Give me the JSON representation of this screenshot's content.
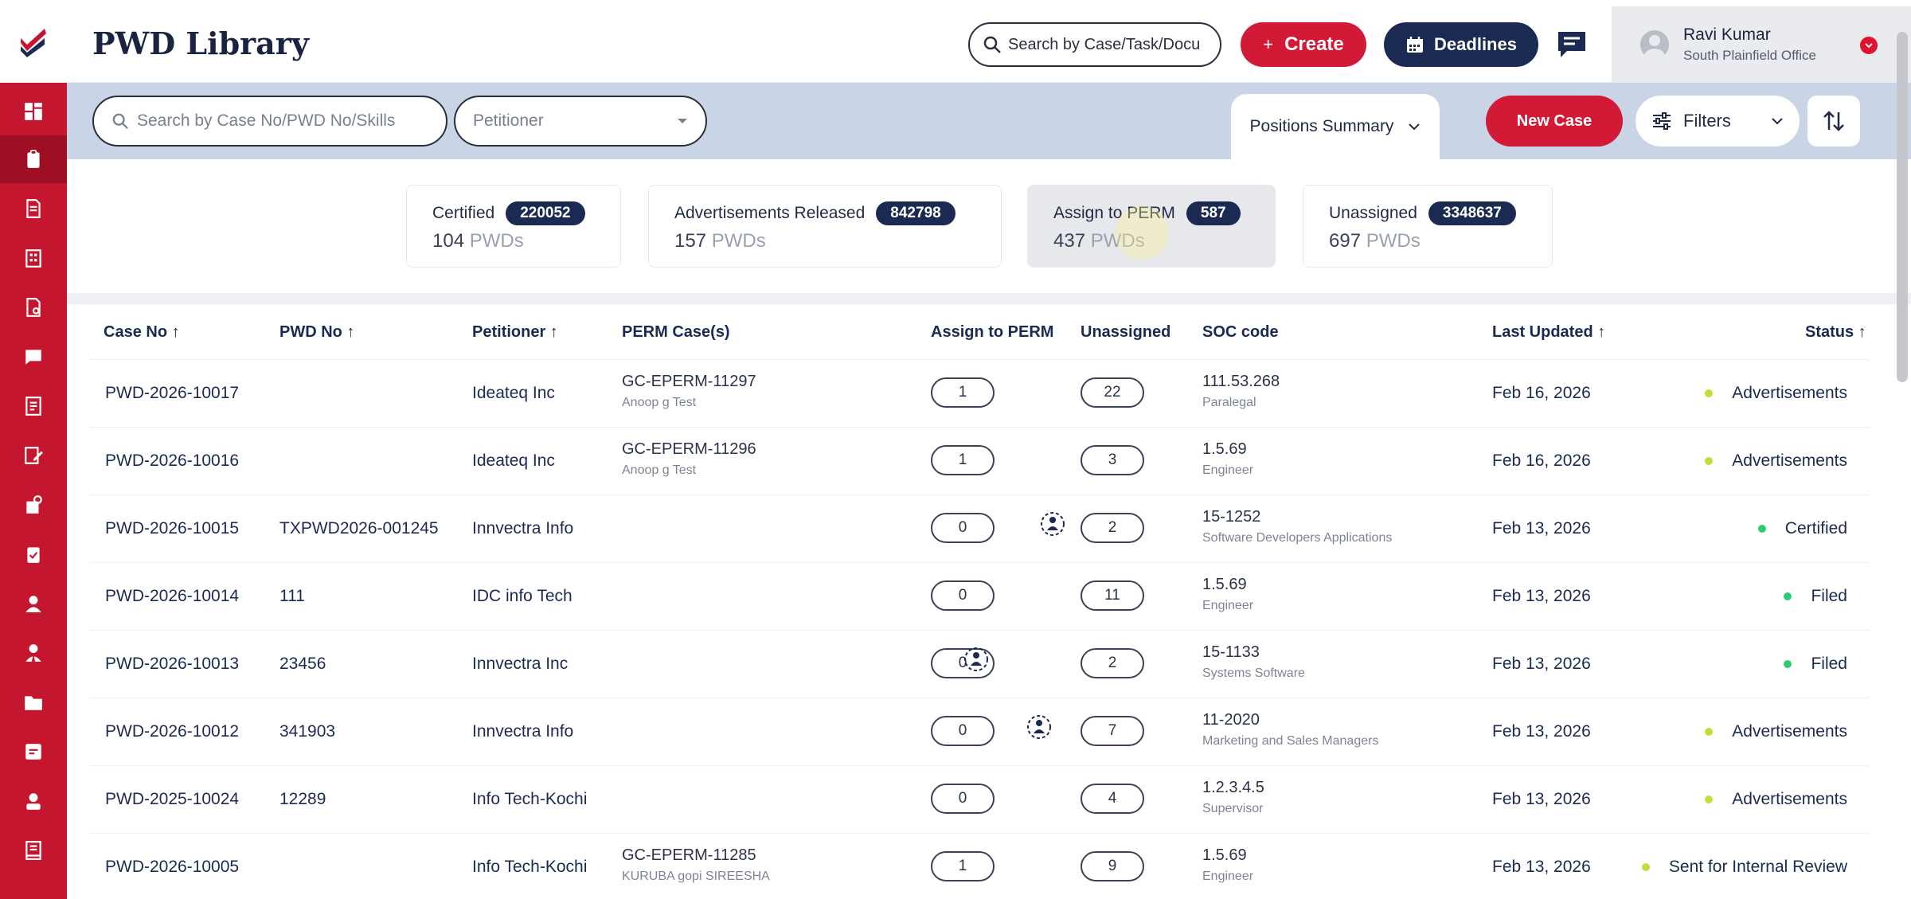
{
  "app": {
    "title": "PWD Library"
  },
  "header": {
    "search_placeholder": "Search by Case/Task/Docu",
    "create_label": "Create",
    "create_plus": "+",
    "deadlines_label": "Deadlines",
    "user": {
      "name": "Ravi Kumar",
      "office": "South Plainfield Office"
    }
  },
  "toolbar": {
    "case_search_placeholder": "Search by Case No/PWD No/Skills",
    "petitioner_placeholder": "Petitioner",
    "positions_summary_label": "Positions Summary",
    "new_case_label": "New Case",
    "filters_label": "Filters"
  },
  "summary_cards": [
    {
      "label": "Certified",
      "count": "220052",
      "pwd_count": "104",
      "pwd_label": "PWDs"
    },
    {
      "label": "Advertisements Released",
      "count": "842798",
      "pwd_count": "157",
      "pwd_label": "PWDs"
    },
    {
      "label": "Assign to PERM",
      "count": "587",
      "pwd_count": "437",
      "pwd_label": "PWDs"
    },
    {
      "label": "Unassigned",
      "count": "3348637",
      "pwd_count": "697",
      "pwd_label": "PWDs"
    }
  ],
  "table": {
    "columns": {
      "case_no": "Case No ↑",
      "pwd_no": "PWD No ↑",
      "petitioner": "Petitioner ↑",
      "perm_cases": "PERM Case(s)",
      "assign_to_perm": "Assign to PERM",
      "unassigned": "Unassigned",
      "soc_code": "SOC code",
      "last_updated": "Last Updated ↑",
      "status": "Status ↑"
    },
    "rows": [
      {
        "case_no": "PWD-2026-10017",
        "pwd_no": "",
        "petitioner": "Ideateq Inc",
        "perm_case": "GC-EPERM-11297",
        "perm_person": "Anoop g Test",
        "assign": "1",
        "unassigned": "22",
        "soc_code": "111.53.268",
        "soc_title": "Paralegal",
        "last_updated": "Feb 16, 2026",
        "status": "Advertisements",
        "status_color": "#c7dc3a"
      },
      {
        "case_no": "PWD-2026-10016",
        "pwd_no": "",
        "petitioner": "Ideateq Inc",
        "perm_case": "GC-EPERM-11296",
        "perm_person": "Anoop g Test",
        "assign": "1",
        "unassigned": "3",
        "soc_code": "1.5.69",
        "soc_title": "Engineer",
        "last_updated": "Feb 16, 2026",
        "status": "Advertisements",
        "status_color": "#c7dc3a"
      },
      {
        "case_no": "PWD-2026-10015",
        "pwd_no": "TXPWD2026-001245",
        "petitioner": "Innvectra Info",
        "perm_case": "",
        "perm_person": "",
        "assign": "0",
        "unassigned": "2",
        "soc_code": "15-1252",
        "soc_title": "Software Developers Applications",
        "last_updated": "Feb 13, 2026",
        "status": "Certified",
        "status_color": "#2ecc71"
      },
      {
        "case_no": "PWD-2026-10014",
        "pwd_no": "111",
        "petitioner": "IDC info Tech",
        "perm_case": "",
        "perm_person": "",
        "assign": "0",
        "unassigned": "11",
        "soc_code": "1.5.69",
        "soc_title": "Engineer",
        "last_updated": "Feb 13, 2026",
        "status": "Filed",
        "status_color": "#2ecc71"
      },
      {
        "case_no": "PWD-2026-10013",
        "pwd_no": "23456",
        "petitioner": "Innvectra Inc",
        "perm_case": "",
        "perm_person": "",
        "assign": "0",
        "unassigned": "2",
        "soc_code": "15-1133",
        "soc_title": "Systems Software",
        "last_updated": "Feb 13, 2026",
        "status": "Filed",
        "status_color": "#2ecc71"
      },
      {
        "case_no": "PWD-2026-10012",
        "pwd_no": "341903",
        "petitioner": "Innvectra Info",
        "perm_case": "",
        "perm_person": "",
        "assign": "0",
        "unassigned": "7",
        "soc_code": "11-2020",
        "soc_title": "Marketing and Sales Managers",
        "last_updated": "Feb 13, 2026",
        "status": "Advertisements",
        "status_color": "#c7dc3a"
      },
      {
        "case_no": "PWD-2025-10024",
        "pwd_no": "12289",
        "petitioner": "Info Tech-Kochi",
        "perm_case": "",
        "perm_person": "",
        "assign": "0",
        "unassigned": "4",
        "soc_code": "1.2.3.4.5",
        "soc_title": "Supervisor",
        "last_updated": "Feb 13, 2026",
        "status": "Advertisements",
        "status_color": "#c7dc3a"
      },
      {
        "case_no": "PWD-2026-10005",
        "pwd_no": "",
        "petitioner": "Info Tech-Kochi",
        "perm_case": "GC-EPERM-11285",
        "perm_person": "KURUBA gopi SIREESHA",
        "assign": "1",
        "unassigned": "9",
        "soc_code": "1.5.69",
        "soc_title": "Engineer",
        "last_updated": "Feb 13, 2026",
        "status": "Sent for Internal Review",
        "status_color": "#c7dc3a"
      }
    ]
  },
  "colors": {
    "brand_red": "#c4162f",
    "navy": "#1b2a52",
    "toolbar_bg": "#c9d5e7"
  },
  "icons": [
    "logo-icon",
    "dashboard-icon",
    "search-icon",
    "calendar-icon",
    "chat-icon",
    "chevron-down-icon",
    "filter-icon",
    "sort-icon",
    "close-icon",
    "people-group-icon"
  ]
}
